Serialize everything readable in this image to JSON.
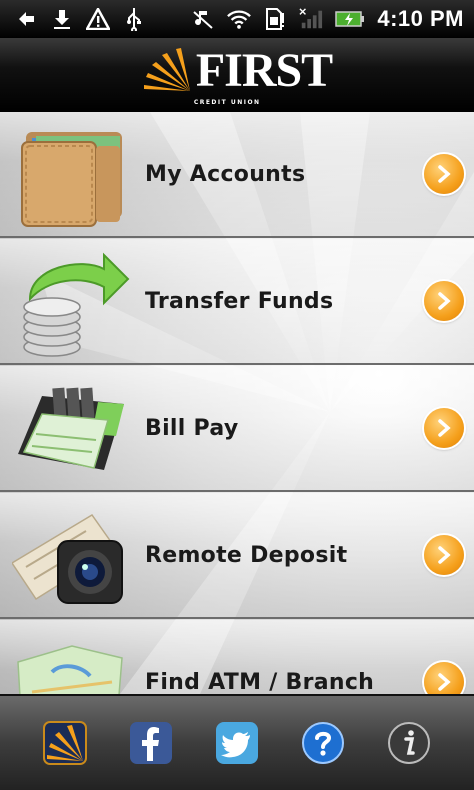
{
  "status_bar": {
    "time": "4:10 PM",
    "icons": [
      "back-icon",
      "download-icon",
      "warning-icon",
      "usb-icon",
      "muted-icon",
      "wifi-icon",
      "sim-icon",
      "signal-icon",
      "battery-icon"
    ]
  },
  "header": {
    "logo_text": "FIRST",
    "logo_subtext": "CREDIT UNION"
  },
  "menu": {
    "items": [
      {
        "label": "My Accounts",
        "icon": "wallet-icon"
      },
      {
        "label": "Transfer Funds",
        "icon": "coins-arrow-icon"
      },
      {
        "label": "Bill Pay",
        "icon": "checkbook-icon"
      },
      {
        "label": "Remote Deposit",
        "icon": "camera-check-icon"
      },
      {
        "label": "Find ATM / Branch",
        "icon": "map-icon"
      }
    ]
  },
  "toolbar": {
    "items": [
      "first-logo-icon",
      "facebook-icon",
      "twitter-icon",
      "help-icon",
      "info-icon"
    ],
    "colors": {
      "facebook": "#3b5998",
      "twitter": "#4aa8e0",
      "help": "#1e6fd1",
      "accent": "#f5a01c"
    }
  }
}
